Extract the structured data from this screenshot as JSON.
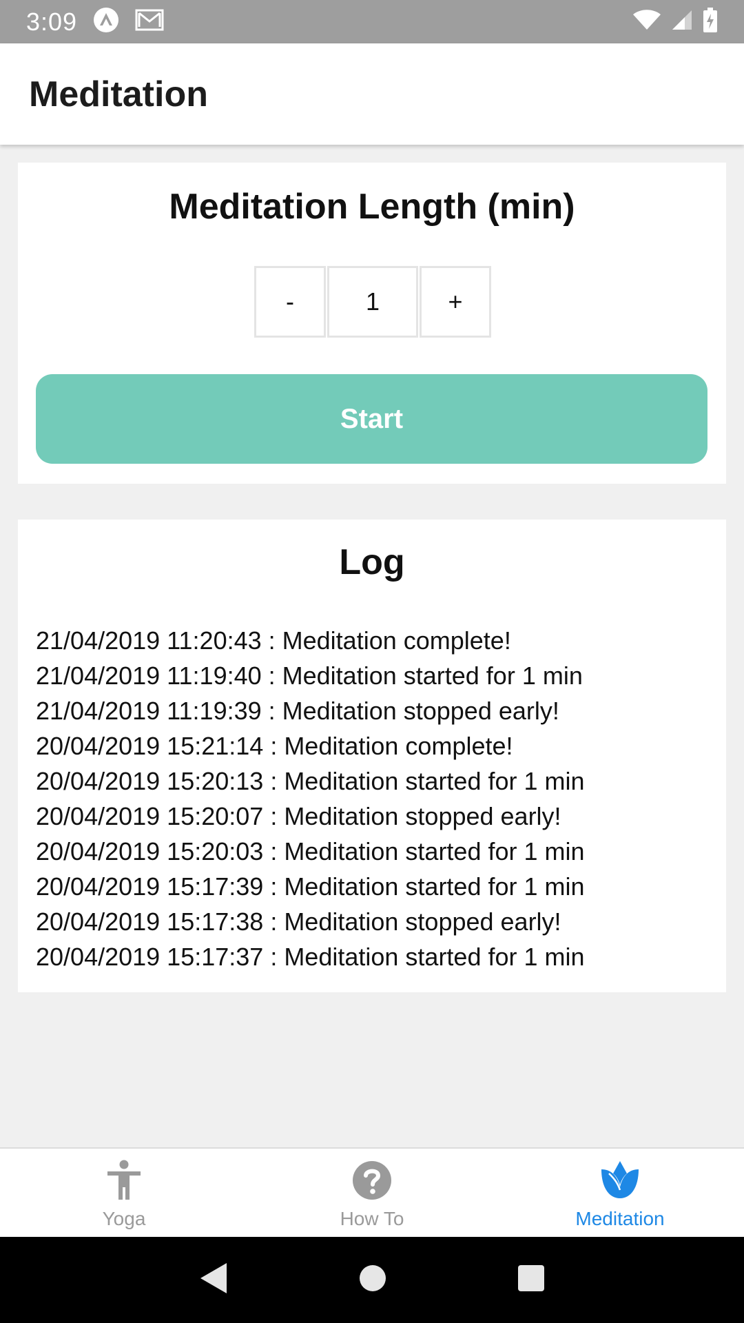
{
  "status_bar": {
    "time": "3:09"
  },
  "app_bar": {
    "title": "Meditation"
  },
  "length_card": {
    "heading": "Meditation Length (min)",
    "decrement_label": "-",
    "value": "1",
    "increment_label": "+",
    "start_label": "Start",
    "start_color": "#73cbb9"
  },
  "log_card": {
    "heading": "Log",
    "entries": [
      "21/04/2019 11:20:43 : Meditation complete!",
      "21/04/2019 11:19:40 : Meditation started for 1 min",
      "21/04/2019 11:19:39 : Meditation stopped early!",
      "20/04/2019 15:21:14 : Meditation complete!",
      "20/04/2019 15:20:13 : Meditation started for 1 min",
      "20/04/2019 15:20:07 : Meditation stopped early!",
      "20/04/2019 15:20:03 : Meditation started for 1 min",
      "20/04/2019 15:17:39 : Meditation started for 1 min",
      "20/04/2019 15:17:38 : Meditation stopped early!",
      "20/04/2019 15:17:37 : Meditation started for 1 min"
    ]
  },
  "bottom_nav": {
    "items": [
      {
        "label": "Yoga",
        "icon": "person-icon",
        "active": false
      },
      {
        "label": "How To",
        "icon": "help-circle-icon",
        "active": false
      },
      {
        "label": "Meditation",
        "icon": "lotus-icon",
        "active": true
      }
    ],
    "active_color": "#1e88e5",
    "inactive_color": "#9a9a9a"
  }
}
